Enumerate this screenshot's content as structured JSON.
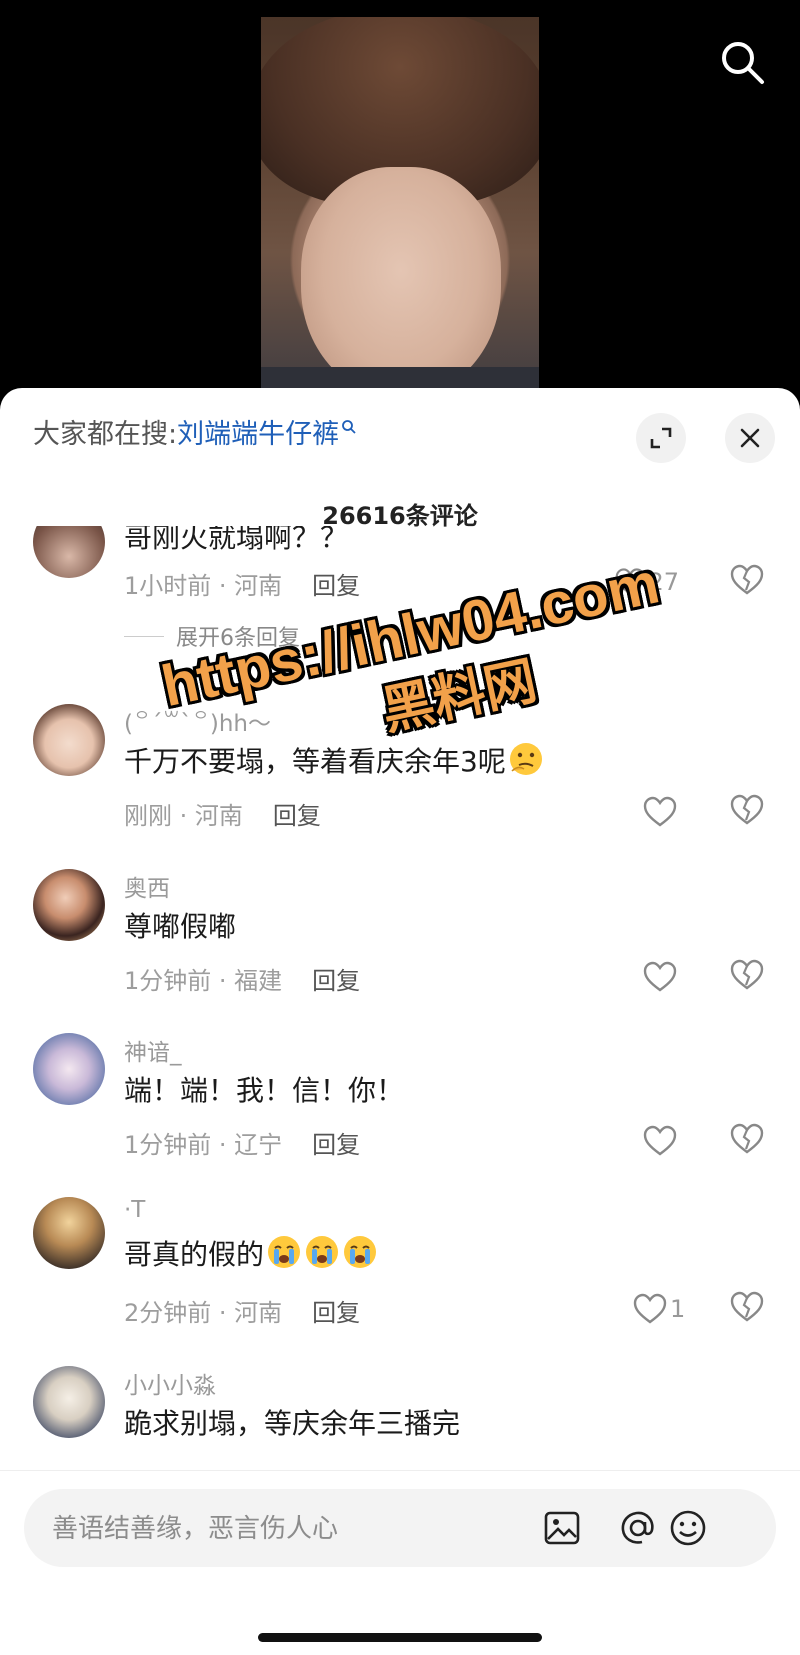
{
  "header": {
    "trending_prefix": "大家都在搜:",
    "trending_keyword": "刘端端牛仔裤"
  },
  "comment_count": "26616条评论",
  "comments": [
    {
      "name": "",
      "text": "哥刚火就塌啊？？",
      "time_location": "1小时前 · 河南",
      "reply": "回复",
      "likes": "27"
    },
    {
      "name": "(꒪ˊ꒳ˋ꒪)hh～",
      "text": "千万不要塌，等着看庆余年3呢",
      "time_location": "刚刚 · 河南",
      "reply": "回复",
      "likes": ""
    },
    {
      "name": "奥西",
      "text": "尊嘟假嘟",
      "time_location": "1分钟前 · 福建",
      "reply": "回复",
      "likes": ""
    },
    {
      "name": "神谙_",
      "text": "端！端！我！信！你！",
      "time_location": "1分钟前 · 辽宁",
      "reply": "回复",
      "likes": ""
    },
    {
      "name": "·T",
      "text": "哥真的假的",
      "time_location": "2分钟前 · 河南",
      "reply": "回复",
      "likes": "1"
    },
    {
      "name": "小小小淼",
      "text": "跪求别塌，等庆余年三播完",
      "time_location": "",
      "reply": "",
      "likes": ""
    }
  ],
  "expand_replies": "展开6条回复",
  "input": {
    "placeholder": "善语结善缘，恶言伤人心"
  },
  "watermark": {
    "line1": "https://ihlw04.com",
    "line2": "黑料网"
  },
  "icons": {
    "top": "search-icon",
    "header_buttons": [
      "expand-icon",
      "close-icon"
    ],
    "comment_actions": [
      "heart-icon",
      "broken-heart-icon"
    ],
    "input_actions": [
      "image-icon",
      "at-icon",
      "emoji-icon"
    ]
  },
  "colors": {
    "keyword": "#1f5fb8",
    "watermark": "#f2a14a"
  }
}
